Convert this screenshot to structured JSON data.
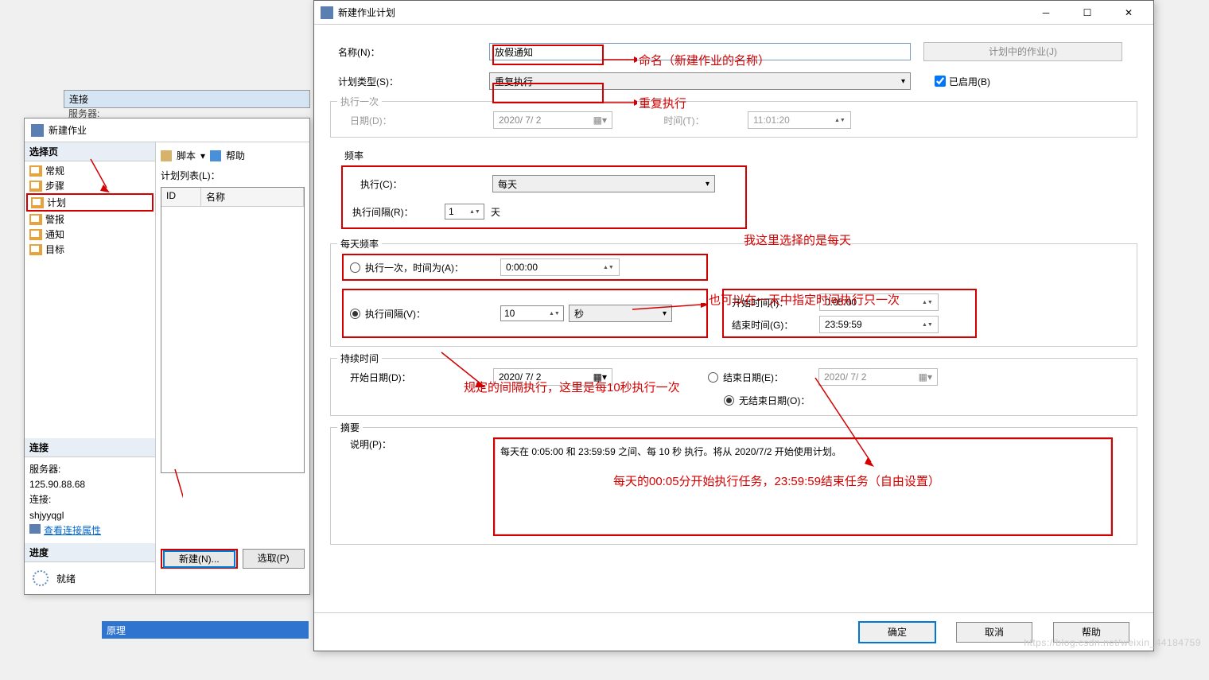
{
  "bg": {
    "connect": "连接",
    "server_label": "服务器:",
    "blue_row": "原理"
  },
  "win1": {
    "title": "新建作业",
    "select_page": "选择页",
    "nav": [
      "常规",
      "步骤",
      "计划",
      "警报",
      "通知",
      "目标"
    ],
    "toolbar_script": "脚本",
    "toolbar_help": "帮助",
    "list_label": "计划列表(L)：",
    "col_id": "ID",
    "col_name": "名称",
    "btn_new": "新建(N)...",
    "btn_pick": "选取(P)",
    "conn_header": "连接",
    "server_label": "服务器:",
    "server_val": "125.90.88.68",
    "conn_label": "连接:",
    "conn_val": "shjyyqgl",
    "view_props": "查看连接属性",
    "progress_header": "进度",
    "ready": "就绪"
  },
  "win2": {
    "title": "新建作业计划",
    "name_label": "名称(N)：",
    "name_value": "放假通知",
    "plan_btn": "计划中的作业(J)",
    "type_label": "计划类型(S)：",
    "type_value": "重复执行",
    "enabled_label": "已启用(B)",
    "once_group": "执行一次",
    "once_date_label": "日期(D)：",
    "once_date_val": "2020/ 7/ 2",
    "once_time_label": "时间(T)：",
    "once_time_val": "11:01:20",
    "freq_group": "频率",
    "exec_label": "执行(C)：",
    "exec_value": "每天",
    "interval_label": "执行间隔(R)：",
    "interval_val": "1",
    "interval_unit": "天",
    "daily_group": "每天频率",
    "daily_once_label": "执行一次，时间为(A)：",
    "daily_once_time": "0:00:00",
    "daily_interval_label": "执行间隔(V)：",
    "daily_interval_val": "10",
    "daily_interval_unit": "秒",
    "start_time_label": "开始时间(I)：",
    "start_time_val": "0:05:00",
    "end_time_label": "结束时间(G)：",
    "end_time_val": "23:59:59",
    "duration_group": "持续时间",
    "start_date_label": "开始日期(D)：",
    "start_date_val": "2020/ 7/ 2",
    "end_date_label": "结束日期(E)：",
    "end_date_val": "2020/ 7/ 2",
    "no_end_label": "无结束日期(O)：",
    "summary_group": "摘要",
    "desc_label": "说明(P)：",
    "desc_text": "每天在 0:05:00 和 23:59:59 之间、每 10 秒 执行。将从 2020/7/2 开始使用计划。",
    "ok": "确定",
    "cancel": "取消",
    "help": "帮助"
  },
  "annots": {
    "a1": "命名（新建作业的名称）",
    "a2": "重复执行",
    "a3": "我这里选择的是每天",
    "a4": "也可以在一天中指定时间执行只一次",
    "a5": "规定的间隔执行，这里是每10秒执行一次",
    "a6": "每天的00:05分开始执行任务，23:59:59结束任务（自由设置）"
  },
  "watermark": "https://blog.csdn.net/weixin_44184759"
}
